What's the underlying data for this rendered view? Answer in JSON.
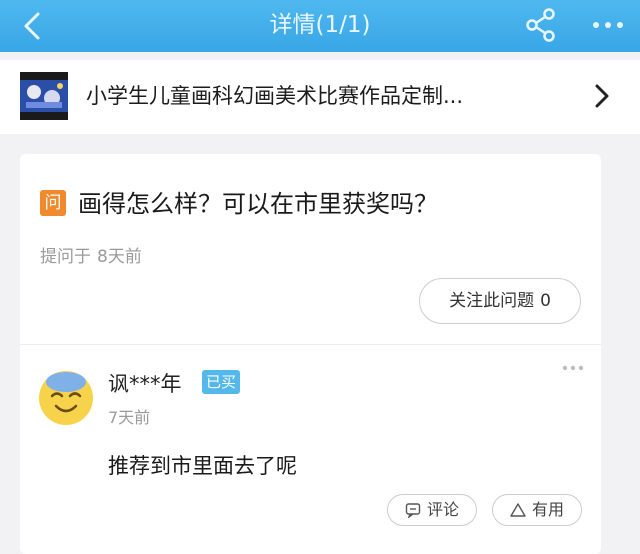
{
  "header": {
    "title": "详情(1/1)",
    "icons": [
      "back-icon",
      "share-icon",
      "more-icon"
    ]
  },
  "product": {
    "title": "小学生儿童画科幻画美术比赛作品定制..."
  },
  "question": {
    "icon_label": "问",
    "text": "画得怎么样？可以在市里获奖吗？",
    "meta_prefix": "提问于",
    "meta_time": "8天前",
    "follow_label": "关注此问题",
    "follow_count": "0"
  },
  "answer": {
    "user": "讽***年",
    "badge": "已买",
    "time": "7天前",
    "text": "推荐到市里面去了呢",
    "comment_label": "评论",
    "useful_label": "有用"
  },
  "colors": {
    "header": "#3ea9e8",
    "question_icon": "#f08a2c",
    "badge": "#55b8ea"
  }
}
